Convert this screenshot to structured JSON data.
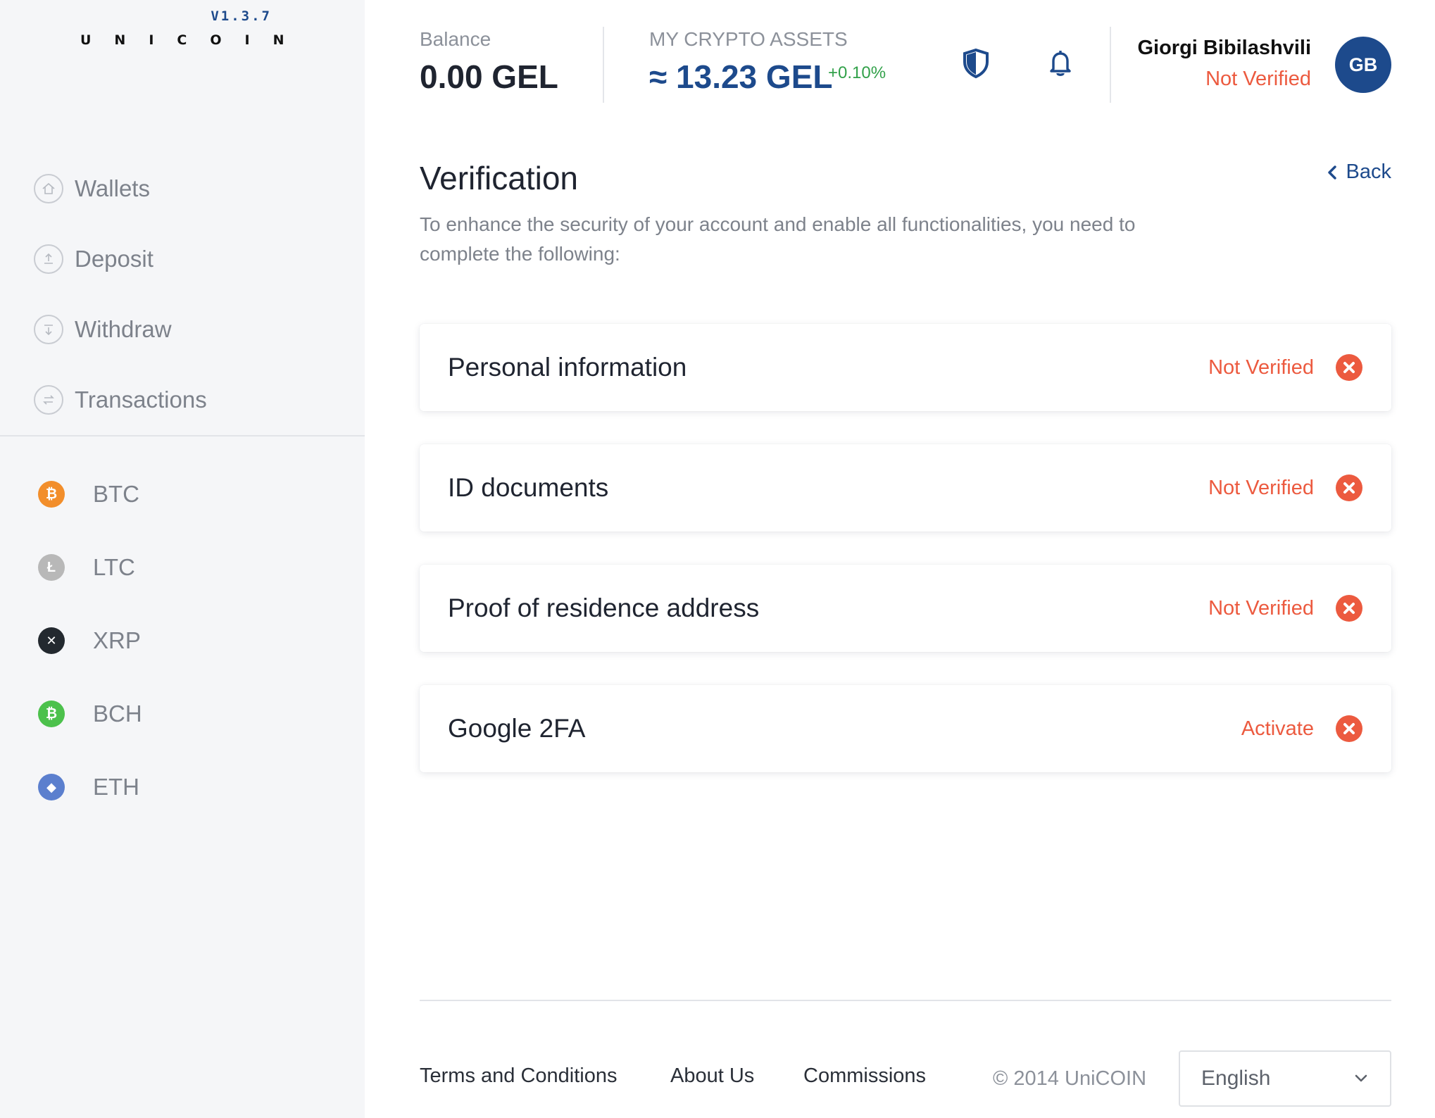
{
  "brand": {
    "version": "V1.3.7",
    "wordmark": "UNICOIN"
  },
  "sidebar": {
    "nav": [
      {
        "label": "Wallets",
        "icon": "home-icon"
      },
      {
        "label": "Deposit",
        "icon": "upload-icon"
      },
      {
        "label": "Withdraw",
        "icon": "download-icon"
      },
      {
        "label": "Transactions",
        "icon": "swap-icon"
      }
    ],
    "coins": [
      {
        "label": "BTC",
        "icon": "bitcoin-icon",
        "color": "#f28e2b",
        "glyph": "₿"
      },
      {
        "label": "LTC",
        "icon": "litecoin-icon",
        "color": "#b8b8b8",
        "glyph": "Ł"
      },
      {
        "label": "XRP",
        "icon": "xrp-icon",
        "color": "#23292f",
        "glyph": "✕"
      },
      {
        "label": "BCH",
        "icon": "bitcoin-cash-icon",
        "color": "#4cc14c",
        "glyph": "₿"
      },
      {
        "label": "ETH",
        "icon": "ethereum-icon",
        "color": "#5b7fce",
        "glyph": "◆"
      }
    ]
  },
  "header": {
    "balance_label": "Balance",
    "balance_value": "0.00 GEL",
    "assets_label": "MY CRYPTO ASSETS",
    "assets_value": "≈ 13.23 GEL",
    "assets_change": "+0.10%",
    "user_name": "Giorgi Bibilashvili",
    "user_status": "Not Verified",
    "avatar_initials": "GB"
  },
  "main": {
    "title": "Verification",
    "back_label": "Back",
    "intro": "To enhance the security of your account and enable all functionalities, you need to complete the following:",
    "items": [
      {
        "title": "Personal information",
        "status": "Not Verified"
      },
      {
        "title": "ID documents",
        "status": "Not Verified"
      },
      {
        "title": "Proof of residence address",
        "status": "Not Verified"
      },
      {
        "title": "Google 2FA",
        "status": "Activate"
      }
    ]
  },
  "footer": {
    "terms": "Terms and Conditions",
    "about": "About Us",
    "commissions": "Commissions",
    "copyright": "© 2014 UniCOIN",
    "language": "English"
  },
  "colors": {
    "accent": "#1d4a8c",
    "error": "#ec5a3f",
    "positive": "#32a14a",
    "sidebar_bg": "#f5f6f8"
  }
}
